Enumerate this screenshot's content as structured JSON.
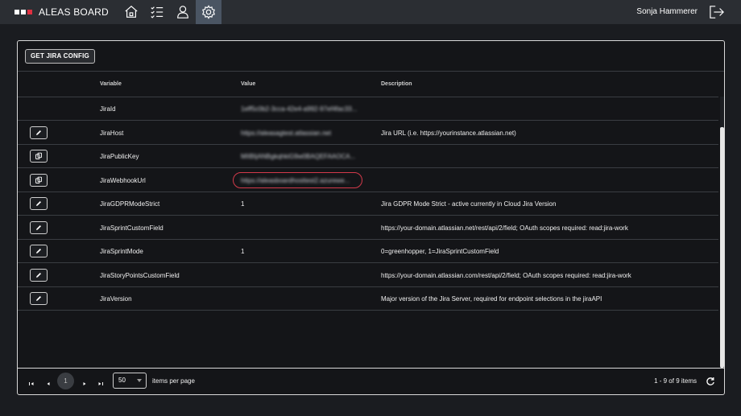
{
  "app": {
    "brand": "ALEAS BOARD",
    "logo_colors": [
      "#ffffff",
      "#ffffff",
      "#e03040"
    ],
    "nav_icons": [
      "home-icon",
      "checklist-icon",
      "user-icon",
      "settings-icon"
    ],
    "active_nav": "settings-icon",
    "user_name": "Sonja Hammerer"
  },
  "toolbar": {
    "get_config_label": "GET JIRA CONFIG"
  },
  "table": {
    "headers": {
      "variable": "Variable",
      "value": "Value",
      "description": "Description"
    },
    "rows": [
      {
        "action": "none",
        "variable": "JiraId",
        "value": "1eff5c0b2-3cca-42e4-a992-97ef4fac33...",
        "blurred": true,
        "description": ""
      },
      {
        "action": "edit",
        "variable": "JiraHost",
        "value": "https://aleasagtest.atlassian.net",
        "blurred": true,
        "description": "Jira URL (i.e. https://yourinstance.atlassian.net)"
      },
      {
        "action": "copy",
        "variable": "JiraPublicKey",
        "value": "MIIBIjANBgkqhkiG9w0BAQEFAAOCA...",
        "blurred": true,
        "description": ""
      },
      {
        "action": "copy",
        "variable": "JiraWebhookUrl",
        "value": "https://aleasboardhosttest2.azurewe...",
        "blurred": true,
        "highlighted": true,
        "description": ""
      },
      {
        "action": "edit",
        "variable": "JiraGDPRModeStrict",
        "value": "1",
        "blurred": false,
        "description": "Jira GDPR Mode Strict - active currently in Cloud Jira Version"
      },
      {
        "action": "edit",
        "variable": "JiraSprintCustomField",
        "value": "",
        "blurred": false,
        "description": "https://your-domain.atlassian.net/rest/api/2/field; OAuth scopes required: read:jira-work"
      },
      {
        "action": "edit",
        "variable": "JiraSprintMode",
        "value": "1",
        "blurred": false,
        "description": "0=greenhopper, 1=JiraSprintCustomField"
      },
      {
        "action": "edit",
        "variable": "JiraStoryPointsCustomField",
        "value": "",
        "blurred": false,
        "description": "https://your-domain.atlassian.com/rest/api/2/field; OAuth scopes required: read:jira-work"
      },
      {
        "action": "edit",
        "variable": "JiraVersion",
        "value": "",
        "blurred": false,
        "description": "Major version of the Jira Server, required for endpoint selections in the jiraAPI"
      }
    ]
  },
  "pagination": {
    "current_page": "1",
    "page_size": "50",
    "per_page_label": "items per page",
    "range_label": "1 - 9 of 9 items"
  },
  "colors": {
    "highlight": "#d23a4a",
    "active_nav_bg": "#4a5563"
  }
}
